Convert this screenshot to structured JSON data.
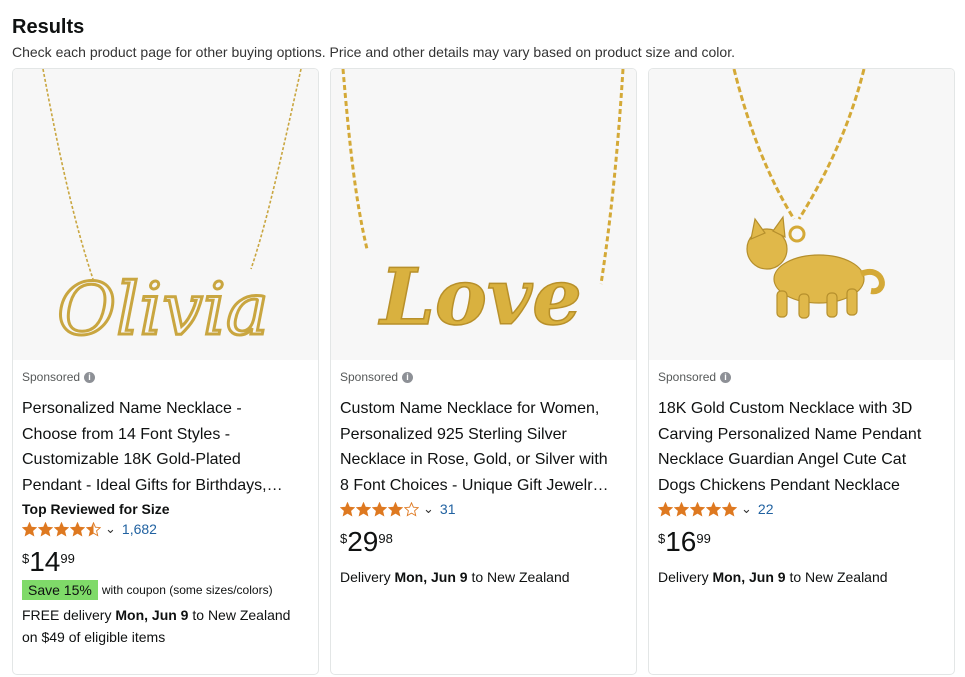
{
  "header": {
    "title": "Results",
    "subtitle": "Check each product page for other buying options. Price and other details may vary based on product size and color."
  },
  "colors": {
    "star": "#de7921",
    "link": "#2162a1",
    "coupon_bg": "#7fda69",
    "gold": "#d4a937"
  },
  "products": [
    {
      "sponsored": "Sponsored",
      "title_lines": [
        "Personalized Name Necklace -",
        "Choose from 14 Font Styles -",
        "Customizable 18K Gold-Plated",
        "Pendant - Ideal Gifts for Birthdays,…"
      ],
      "badge": "Top Reviewed for Size",
      "rating": 4.5,
      "review_count": "1,682",
      "price_symbol": "$",
      "price_whole": "14",
      "price_fraction": "99",
      "coupon_label": "Save 15%",
      "coupon_text": "with coupon (some sizes/colors)",
      "delivery_prefix": "FREE delivery ",
      "delivery_date": "Mon, Jun 9",
      "delivery_suffix": " to New Zealand",
      "delivery_line2": "on $49 of eligible items",
      "pendant_text": "Olivia"
    },
    {
      "sponsored": "Sponsored",
      "title_lines": [
        "Custom Name Necklace for Women,",
        "Personalized 925 Sterling Silver",
        "Necklace in Rose, Gold, or Silver with",
        "8 Font Choices - Unique Gift Jewelr…"
      ],
      "rating": 4.0,
      "review_count": "31",
      "price_symbol": "$",
      "price_whole": "29",
      "price_fraction": "98",
      "delivery_prefix": "Delivery ",
      "delivery_date": "Mon, Jun 9",
      "delivery_suffix": " to New Zealand",
      "pendant_text": "Love"
    },
    {
      "sponsored": "Sponsored",
      "title_lines": [
        "18K Gold Custom Necklace with 3D",
        "Carving Personalized Name Pendant",
        "Necklace Guardian Angel Cute Cat",
        "Dogs Chickens Pendant Necklace"
      ],
      "rating": 5.0,
      "review_count": "22",
      "price_symbol": "$",
      "price_whole": "16",
      "price_fraction": "99",
      "delivery_prefix": "Delivery ",
      "delivery_date": "Mon, Jun 9",
      "delivery_suffix": " to New Zealand"
    }
  ]
}
